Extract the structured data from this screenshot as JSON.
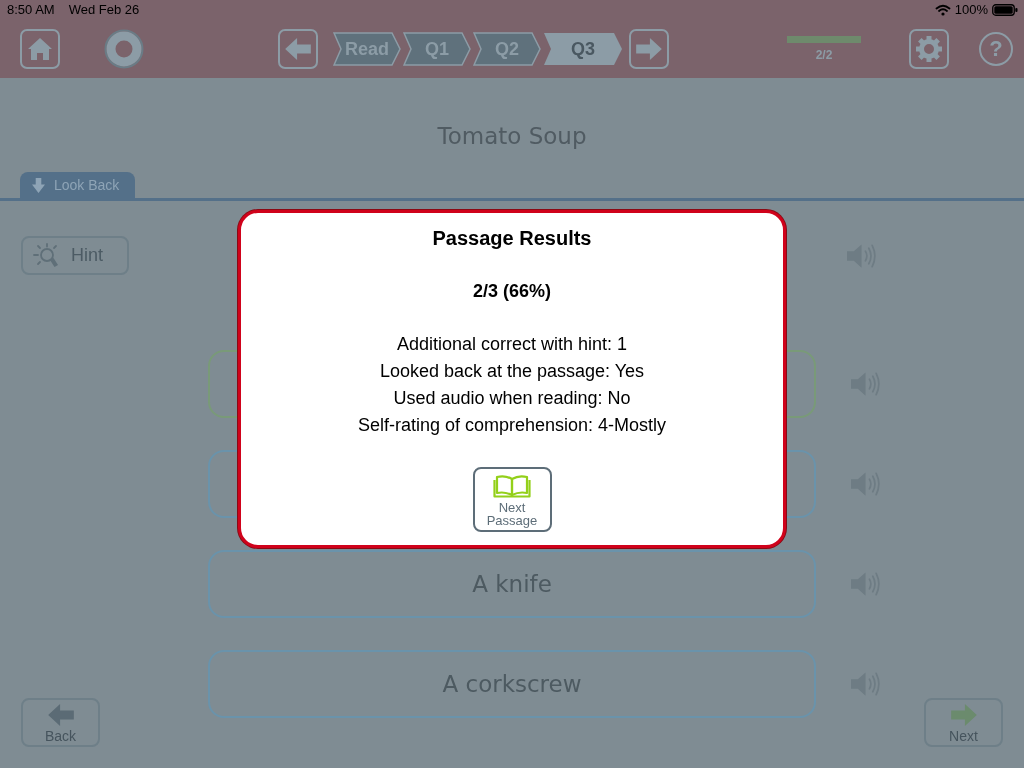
{
  "status_bar": {
    "time": "8:50 AM",
    "date": "Wed Feb 26",
    "battery": "100%"
  },
  "toolbar": {
    "steps": [
      {
        "label": "Read",
        "selected": false
      },
      {
        "label": "Q1",
        "selected": false
      },
      {
        "label": "Q2",
        "selected": false
      },
      {
        "label": "Q3",
        "selected": true
      }
    ],
    "progress": {
      "level": 1,
      "reading": "2/2"
    },
    "help": "?"
  },
  "passage": {
    "title": "Tomato Soup",
    "look_back": "Look Back",
    "hint": "Hint"
  },
  "answers": [
    {
      "selected": true
    },
    {
      "selected": false
    },
    {
      "text": "A knife",
      "selected": false
    },
    {
      "text": "A corkscrew",
      "selected": false
    }
  ],
  "nav": {
    "back": "Back",
    "next": "Next"
  },
  "dialog": {
    "title": "Passage Results",
    "score": "2/3 (66%)",
    "details": [
      "Additional correct with hint: 1",
      "Looked back at the passage: Yes",
      "Used audio when reading: No",
      "Self-rating of comprehension: 4-Mostly"
    ],
    "button": "Next Passage"
  }
}
